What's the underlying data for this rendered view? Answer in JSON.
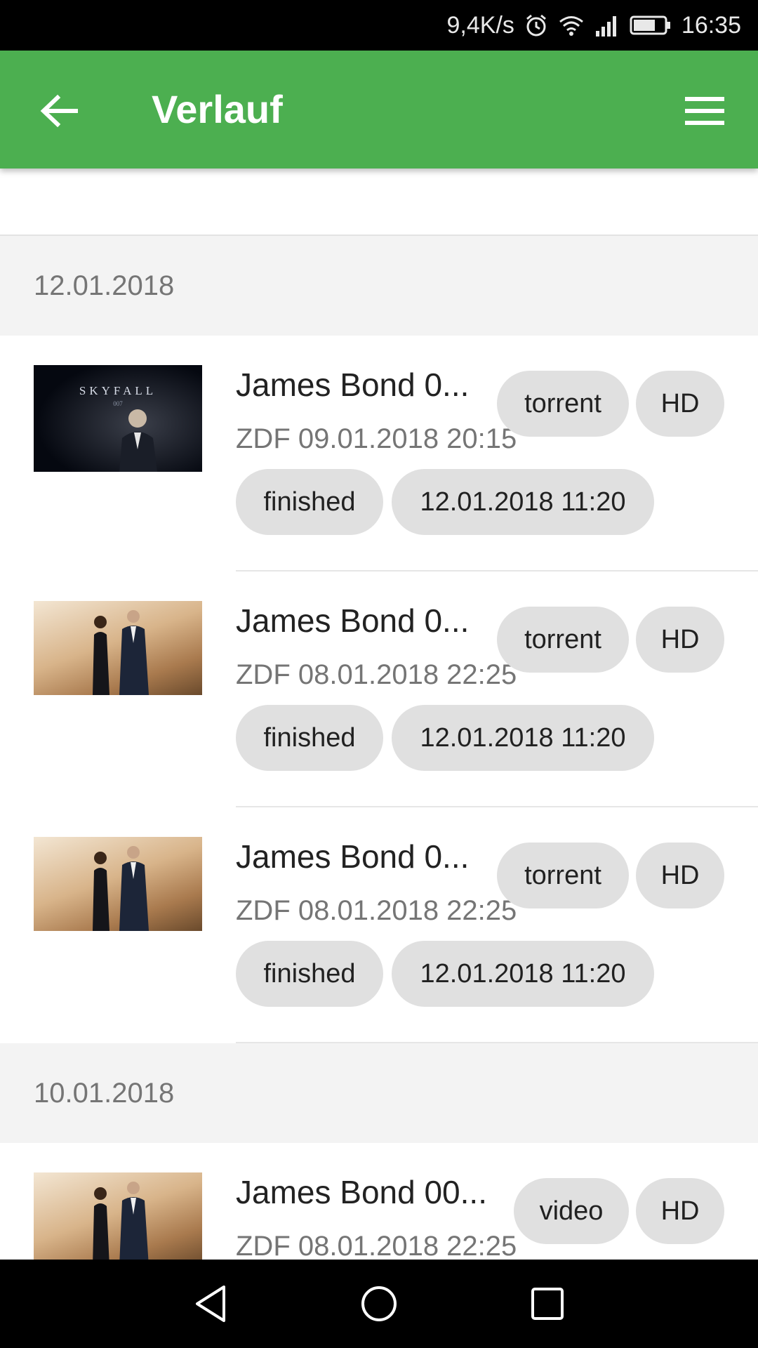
{
  "status_bar": {
    "net_speed": "9,4K/s",
    "time": "16:35",
    "icons": [
      "alarm-icon",
      "wifi-icon",
      "signal-icon",
      "battery-icon"
    ]
  },
  "app_bar": {
    "title": "Verlauf",
    "back_icon": "arrow-left-icon",
    "menu_icon": "hamburger-menu-icon",
    "color": "#4caf50"
  },
  "sections": [
    {
      "date": "12.01.2018",
      "items": [
        {
          "title": "James Bond 0...",
          "subtitle": "ZDF 09.01.2018 20:15",
          "chips_top": [
            "torrent",
            "HD"
          ],
          "chips_bottom": [
            "finished",
            "12.01.2018 11:20"
          ],
          "thumbnail": "skyfall-poster",
          "thumbnail_text": "SKYFALL"
        },
        {
          "title": "James Bond 0...",
          "subtitle": "ZDF 08.01.2018 22:25",
          "chips_top": [
            "torrent",
            "HD"
          ],
          "chips_bottom": [
            "finished",
            "12.01.2018 11:20"
          ],
          "thumbnail": "bond-couple-poster"
        },
        {
          "title": "James Bond 0...",
          "subtitle": "ZDF 08.01.2018 22:25",
          "chips_top": [
            "torrent",
            "HD"
          ],
          "chips_bottom": [
            "finished",
            "12.01.2018 11:20"
          ],
          "thumbnail": "bond-couple-poster"
        }
      ]
    },
    {
      "date": "10.01.2018",
      "items": [
        {
          "title": "James Bond 00...",
          "subtitle": "ZDF 08.01.2018 22:25",
          "chips_top": [
            "video",
            "HD"
          ],
          "thumbnail": "bond-couple-poster"
        }
      ]
    }
  ],
  "nav_bar": {
    "icons": [
      "back-triangle-icon",
      "home-circle-icon",
      "recents-square-icon"
    ]
  }
}
